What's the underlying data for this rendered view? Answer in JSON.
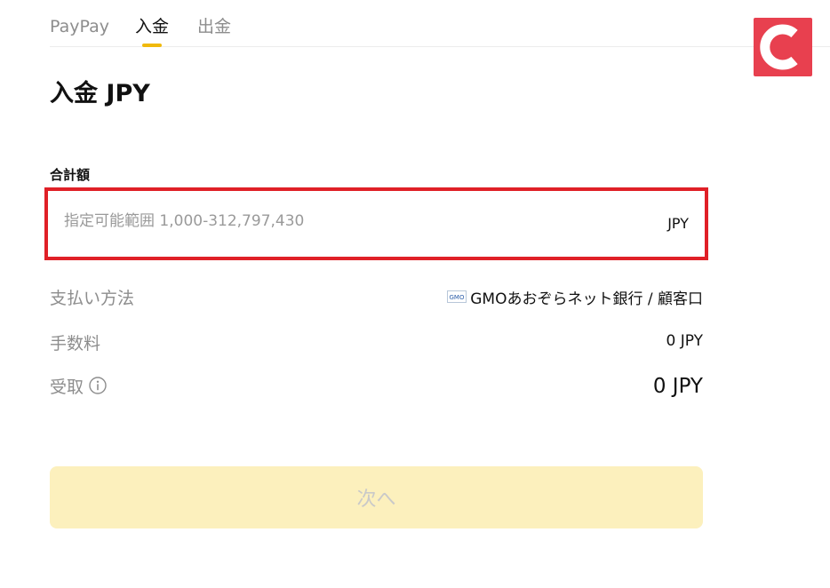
{
  "tabs": [
    {
      "label": "PayPay",
      "active": false
    },
    {
      "label": "入金",
      "active": true
    },
    {
      "label": "出金",
      "active": false
    }
  ],
  "logo": {
    "letter": "C",
    "color": "#e8404f"
  },
  "title": "入金 JPY",
  "amount": {
    "label": "合計額",
    "placeholder": "指定可能範囲 1,000-312,797,430",
    "value": "",
    "unit": "JPY"
  },
  "payment_method": {
    "label": "支払い方法",
    "icon": "gmo-bank-icon",
    "icon_text": "GMO",
    "value": "GMOあおぞらネット銀行 / 顧客口"
  },
  "fee": {
    "label": "手数料",
    "value": "0 JPY"
  },
  "receive": {
    "label": "受取",
    "icon": "info-icon",
    "value": "0 JPY"
  },
  "next_button": {
    "label": "次へ",
    "enabled": false
  },
  "colors": {
    "accent": "#f0b90b",
    "highlight_border": "#e02027",
    "button_disabled_bg": "#fcf0bd"
  }
}
